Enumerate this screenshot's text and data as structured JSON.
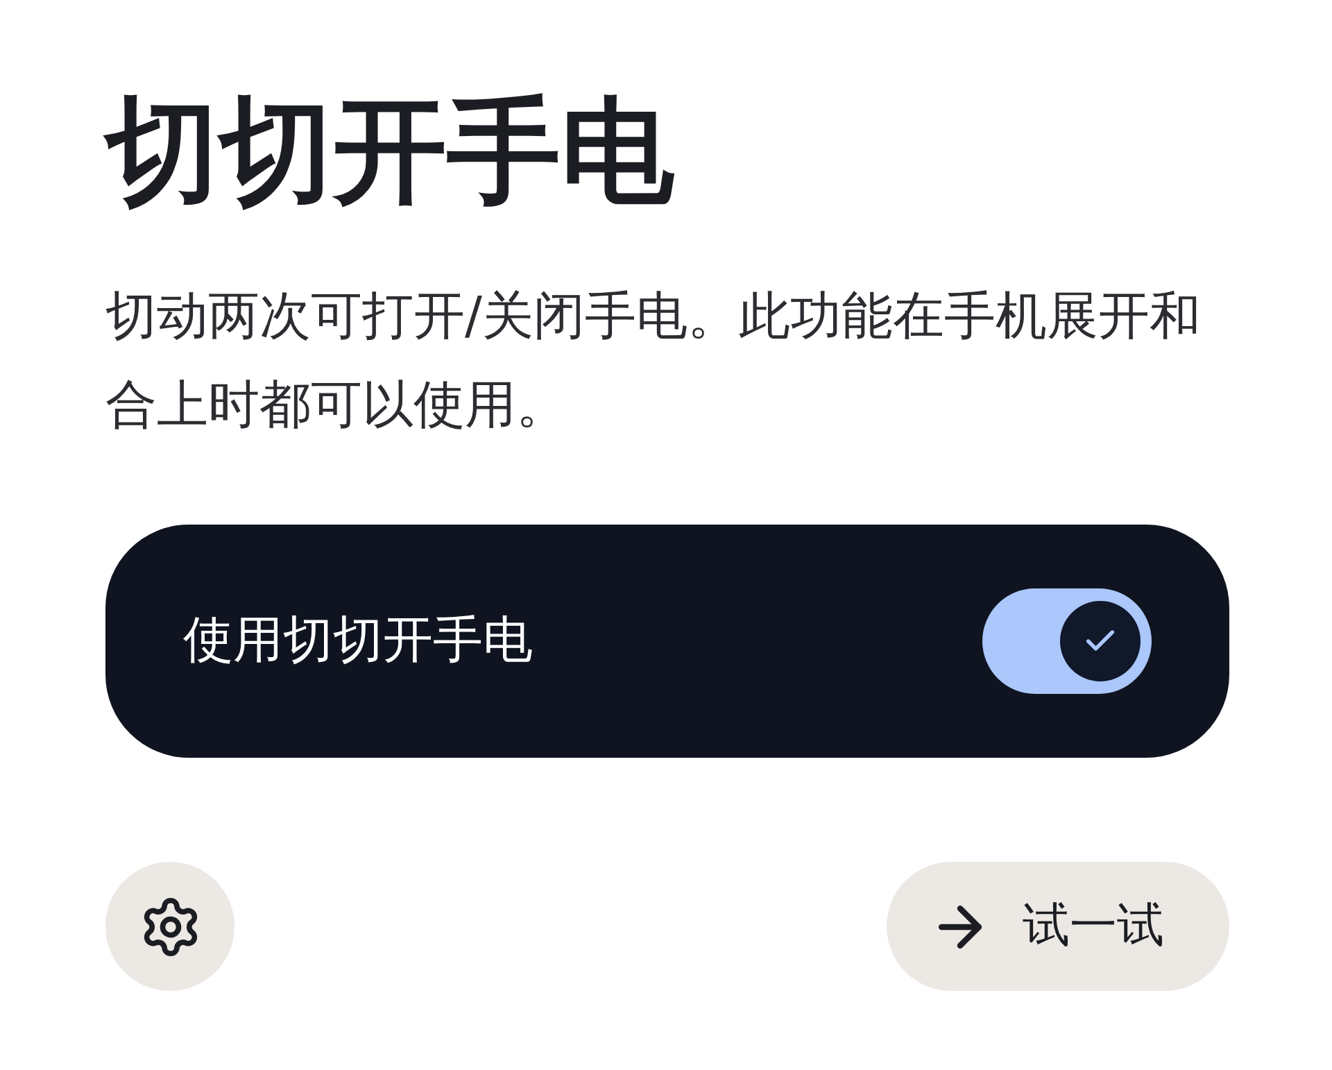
{
  "title": "切切开手电",
  "description": "切动两次可打开/关闭手电。此功能在手机展开和合上时都可以使用。",
  "toggle_card": {
    "label": "使用切切开手电",
    "on": true
  },
  "buttons": [
    {
      "kind": "settings"
    },
    {
      "kind": "try",
      "label": "试一试"
    }
  ]
}
